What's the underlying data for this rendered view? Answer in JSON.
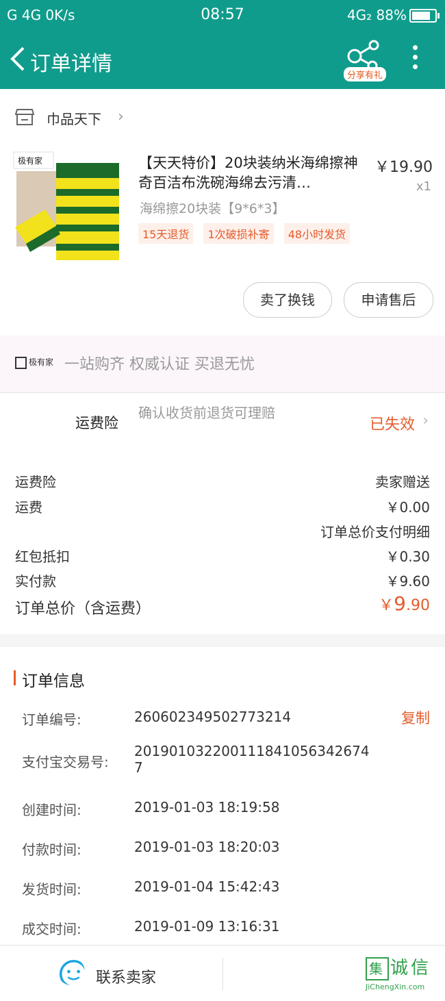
{
  "status_bar": {
    "left": "G  4G  0K/s",
    "time": "08:57",
    "right": "4G₂ 88%"
  },
  "header": {
    "title": "订单详情",
    "share_badge": "分享有礼"
  },
  "shop": {
    "name": "巾品天下"
  },
  "product": {
    "title": "【天天特价】20块装纳米海绵擦神奇百洁布洗碗海绵去污清…",
    "price": "￥19.90",
    "qty": "x1",
    "sku": "海绵擦20块装【9*6*3】",
    "tags": [
      "15天退货",
      "1次破损补寄",
      "48小时发货"
    ],
    "buttons": {
      "sell": "卖了换钱",
      "after_sale": "申请售后"
    }
  },
  "brand_strip": {
    "brand": "极有家",
    "slogan": "一站购齐 权威认证 买退无忧"
  },
  "insurance": {
    "label": "运费险",
    "desc": "确认收货前退货可理赔",
    "state": "已失效"
  },
  "fees": {
    "insurance_label": "运费险",
    "insurance_value": "卖家赠送",
    "shipping_label": "运费",
    "shipping_value": "￥0.00",
    "detail_link": "订单总价支付明细",
    "redpacket_label": "红包抵扣",
    "redpacket_value": "￥0.30",
    "paid_label": "实付款",
    "paid_value": "￥9.60",
    "total_label": "订单总价（含运费）",
    "total_currency": "￥",
    "total_int": "9",
    "total_dec": ".90"
  },
  "order_info": {
    "heading": "订单信息",
    "order_no_label": "订单编号:",
    "order_no": "260602349502773214",
    "copy": "复制",
    "alipay_label": "支付宝交易号:",
    "alipay_no": "2019010322001118410563426747",
    "created_label": "创建时间:",
    "created": "2019-01-03 18:19:58",
    "paid_label": "付款时间:",
    "paid": "2019-01-03 18:20:03",
    "shipped_label": "发货时间:",
    "shipped": "2019-01-04 15:42:43",
    "done_label": "成交时间:",
    "done": "2019-01-09 13:16:31"
  },
  "bottom": {
    "contact": "联系卖家",
    "watermark": "诚信",
    "watermark_url": "JiChengXin.com"
  }
}
